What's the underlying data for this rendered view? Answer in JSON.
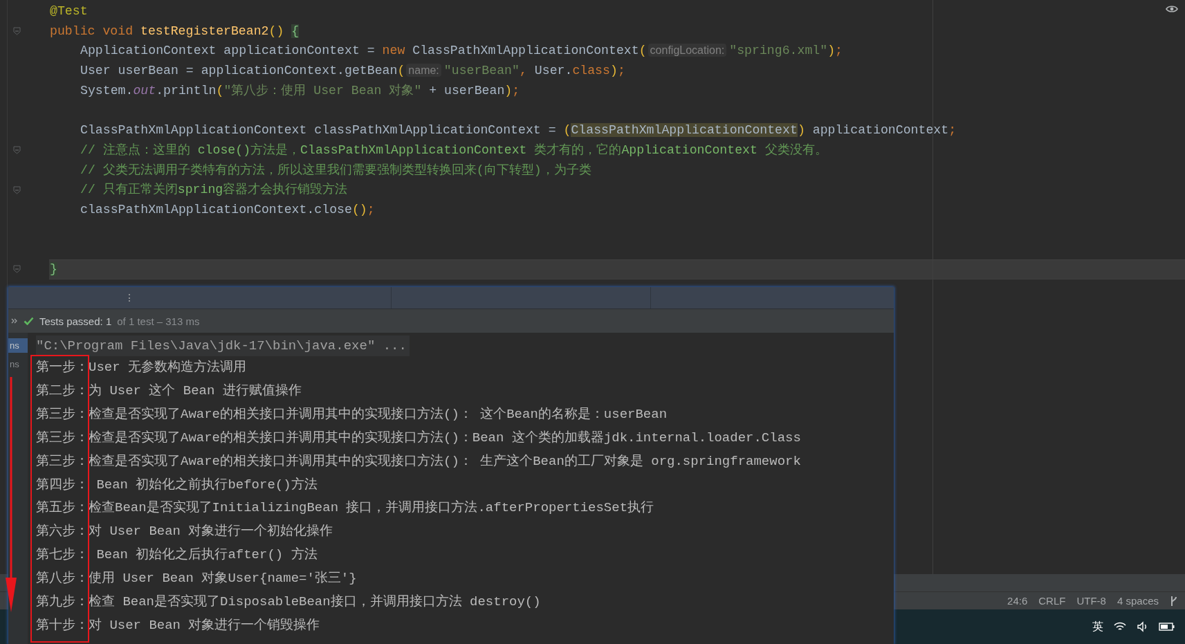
{
  "editor": {
    "lines": [
      {
        "kind": "decl",
        "current": false,
        "fold": false,
        "tokens": [
          {
            "kind": "ann",
            "t": "@Test"
          }
        ]
      },
      {
        "kind": "decl",
        "current": false,
        "fold": true,
        "tokens": [
          {
            "kind": "kw",
            "t": "public void "
          },
          {
            "kind": "fn",
            "t": "testRegisterBean2"
          },
          {
            "kind": "paren",
            "t": "() "
          },
          {
            "kind": "brace",
            "t": "{"
          }
        ]
      },
      {
        "kind": "body",
        "current": false,
        "fold": false,
        "tokens": [
          {
            "kind": "plain",
            "t": "ApplicationContext applicationContext = "
          },
          {
            "kind": "kw",
            "t": "new "
          },
          {
            "kind": "plain",
            "t": "ClassPathXmlApplicationContext"
          },
          {
            "kind": "paren",
            "t": "("
          },
          {
            "kind": "hint",
            "t": "configLocation:"
          },
          {
            "kind": "str",
            "t": "\"spring6.xml\""
          },
          {
            "kind": "paren",
            "t": ")"
          },
          {
            "kind": "kw",
            "t": ";"
          }
        ]
      },
      {
        "kind": "body",
        "current": false,
        "fold": false,
        "tokens": [
          {
            "kind": "plain",
            "t": "User userBean = applicationContext.getBean"
          },
          {
            "kind": "paren",
            "t": "("
          },
          {
            "kind": "hint",
            "t": "name:"
          },
          {
            "kind": "str",
            "t": "\"userBean\""
          },
          {
            "kind": "kw",
            "t": ", "
          },
          {
            "kind": "plain",
            "t": "User."
          },
          {
            "kind": "kw",
            "t": "class"
          },
          {
            "kind": "paren",
            "t": ")"
          },
          {
            "kind": "kw",
            "t": ";"
          }
        ]
      },
      {
        "kind": "body",
        "current": false,
        "fold": false,
        "tokens": [
          {
            "kind": "plain",
            "t": "System."
          },
          {
            "kind": "static",
            "t": "out"
          },
          {
            "kind": "plain",
            "t": ".println"
          },
          {
            "kind": "paren",
            "t": "("
          },
          {
            "kind": "str",
            "t": "\"第八步：使用 User Bean 对象\""
          },
          {
            "kind": "plain",
            "t": " + userBean"
          },
          {
            "kind": "paren",
            "t": ")"
          },
          {
            "kind": "kw",
            "t": ";"
          }
        ]
      },
      {
        "kind": "blank",
        "current": false,
        "fold": false
      },
      {
        "kind": "body",
        "current": false,
        "fold": false,
        "tokens": [
          {
            "kind": "plain",
            "t": "ClassPathXmlApplicationContext classPathXmlApplicationContext = "
          },
          {
            "kind": "paren",
            "t": "("
          },
          {
            "kind": "hl",
            "t": "ClassPathXmlApplicationContext"
          },
          {
            "kind": "paren",
            "t": ")"
          },
          {
            "kind": "plain",
            "t": " applicationContext"
          },
          {
            "kind": "kw",
            "t": ";"
          }
        ]
      },
      {
        "kind": "body",
        "current": false,
        "fold": true,
        "tokens": [
          {
            "kind": "cmt",
            "t": "// 注意点：这里的 "
          },
          {
            "kind": "cmtcode",
            "t": "close()"
          },
          {
            "kind": "cmt",
            "t": "方法是，"
          },
          {
            "kind": "cmtcode",
            "t": "ClassPathXmlApplicationContext"
          },
          {
            "kind": "cmt",
            "t": " 类才有的，它的"
          },
          {
            "kind": "cmtcode",
            "t": "ApplicationContext"
          },
          {
            "kind": "cmt",
            "t": " 父类没有。"
          }
        ]
      },
      {
        "kind": "body",
        "current": false,
        "fold": false,
        "tokens": [
          {
            "kind": "cmt",
            "t": "// 父类无法调用子类特有的方法，所以这里我们需要强制类型转换回来(向下转型)，为子类"
          }
        ]
      },
      {
        "kind": "body",
        "current": false,
        "fold": true,
        "tokens": [
          {
            "kind": "cmt",
            "t": "// 只有正常关闭"
          },
          {
            "kind": "cmtcode",
            "t": "spring"
          },
          {
            "kind": "cmt",
            "t": "容器才会执行销毁方法"
          }
        ]
      },
      {
        "kind": "body",
        "current": false,
        "fold": false,
        "tokens": [
          {
            "kind": "plain",
            "t": "classPathXmlApplicationContext.close"
          },
          {
            "kind": "paren",
            "t": "()"
          },
          {
            "kind": "kw",
            "t": ";"
          }
        ]
      },
      {
        "kind": "blank",
        "current": false,
        "fold": false
      },
      {
        "kind": "blank",
        "current": false,
        "fold": false
      },
      {
        "kind": "decl",
        "current": true,
        "fold": true,
        "tokens": [
          {
            "kind": "brace",
            "t": "}"
          }
        ]
      }
    ]
  },
  "run_panel": {
    "side_tabs": [
      {
        "label": "ns",
        "selected": true
      },
      {
        "label": "ns",
        "selected": false
      }
    ],
    "test_status": {
      "passed": "Tests passed: 1",
      "detail": "of 1 test – 313 ms"
    },
    "command": "\"C:\\Program Files\\Java\\jdk-17\\bin\\java.exe\" ...",
    "output": [
      "第一步：User 无参数构造方法调用",
      "第二步：为 User 这个 Bean 进行赋值操作",
      "第三步：检查是否实现了Aware的相关接口并调用其中的实现接口方法()： 这个Bean的名称是：userBean",
      "第三步：检查是否实现了Aware的相关接口并调用其中的实现接口方法()：Bean 这个类的加载器jdk.internal.loader.Class",
      "第三步：检查是否实现了Aware的相关接口并调用其中的实现接口方法()： 生产这个Bean的工厂对象是 org.springframework",
      "第四步： Bean 初始化之前执行before()方法",
      "第五步：检查Bean是否实现了InitializingBean 接口，并调用接口方法.afterPropertiesSet执行",
      "第六步：对 User Bean 对象进行一个初始化操作",
      "第七步： Bean 初始化之后执行after() 方法",
      "第八步：使用 User Bean 对象User{name='张三'}",
      "第九步：检查 Bean是否实现了DisposableBean接口，并调用接口方法 destroy()",
      "第十步：对 User Bean 对象进行一个销毁操作"
    ]
  },
  "status_bar": [
    "24:6",
    "CRLF",
    "UTF-8",
    "4 spaces"
  ],
  "taskbar": {
    "ime": "英"
  }
}
